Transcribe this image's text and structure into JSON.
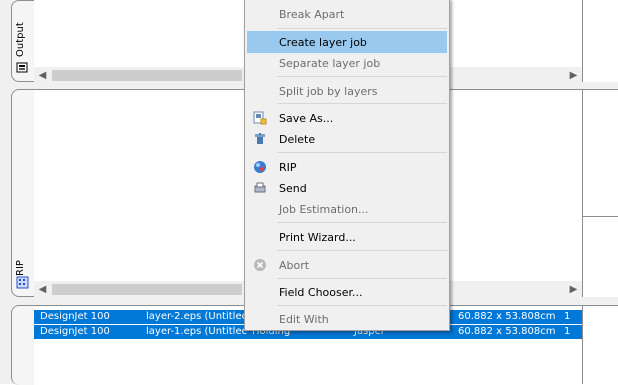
{
  "tabs": {
    "output_label": "Output",
    "rip_label": "RIP"
  },
  "context_menu": {
    "items": [
      {
        "label": "Break Apart",
        "enabled": false
      },
      {
        "label": "Create layer job",
        "enabled": true,
        "highlighted": true
      },
      {
        "label": "Separate layer job",
        "enabled": false
      },
      {
        "label": "Split job by layers",
        "enabled": false
      },
      {
        "label": "Save As...",
        "enabled": true,
        "icon": "save-icon"
      },
      {
        "label": "Delete",
        "enabled": true,
        "icon": "delete-icon"
      },
      {
        "label": "RIP",
        "enabled": true,
        "icon": "rip-icon"
      },
      {
        "label": "Send",
        "enabled": true,
        "icon": "send-icon"
      },
      {
        "label": "Job Estimation...",
        "enabled": false
      },
      {
        "label": "Print Wizard...",
        "enabled": true
      },
      {
        "label": "Abort",
        "enabled": false,
        "icon": "abort-icon"
      },
      {
        "label": "Field Chooser...",
        "enabled": true
      },
      {
        "label": "Edit With",
        "enabled": false
      }
    ]
  },
  "jobs": [
    {
      "printer": "DesignJet 100",
      "name": "layer-2.eps (Untitlec",
      "size": "60.882 x 53.808cm",
      "copies": "1"
    },
    {
      "printer": "DesignJet 100",
      "name": "layer-1.eps (Untitlec",
      "status": "Holding",
      "user": "Jasper",
      "size": "60.882 x 53.808cm",
      "copies": "1"
    }
  ],
  "colors": {
    "selection": "#0078d7",
    "menu_highlight": "#99c9ef"
  }
}
